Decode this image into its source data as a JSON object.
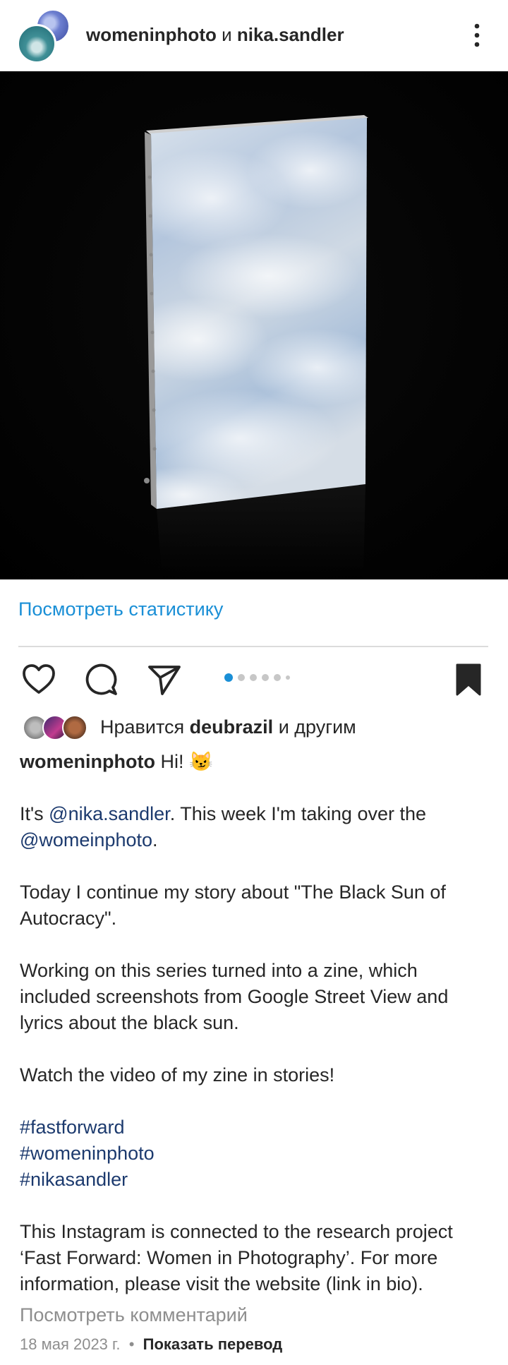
{
  "header": {
    "user1": "womeninphoto",
    "conjunction": "и",
    "user2": "nika.sandler"
  },
  "stats_link": "Посмотреть статистику",
  "carousel": {
    "count": 6,
    "active_index": 0
  },
  "likes": {
    "prefix": "Нравится",
    "user": "deubrazil",
    "suffix": "и другим"
  },
  "caption": {
    "author": "womeninphoto",
    "greeting": "Hi! 😼",
    "line1_pre": "It's ",
    "mention1": "@nika.sandler",
    "line1_post": ". This week I'm taking over the",
    "mention2": "@womeinphoto",
    "line2_post": ".",
    "para2": "Today I continue my story about \"The Black Sun of Autocracy\".",
    "para3": "Working on this series turned into a zine, which included screenshots from Google Street View and lyrics about the black sun.",
    "para4": "Watch the video of my zine in stories!",
    "hashtags": [
      "#fastforward",
      "#womeninphoto",
      "#nikasandler"
    ],
    "para5": "This Instagram is connected to the research project ‘Fast Forward: Women in Photography’. For more information, please visit the website (link in bio)."
  },
  "comments_link": "Посмотреть комментарий",
  "footer": {
    "date": "18 мая 2023 г.",
    "separator": "•",
    "translate": "Показать перевод"
  },
  "colors": {
    "link_blue": "#1a8fd6",
    "mention": "#1c3a6e",
    "muted": "#8e8e8e"
  },
  "icons": [
    "more-vertical-icon",
    "heart-icon",
    "comment-icon",
    "share-icon",
    "bookmark-filled-icon"
  ]
}
